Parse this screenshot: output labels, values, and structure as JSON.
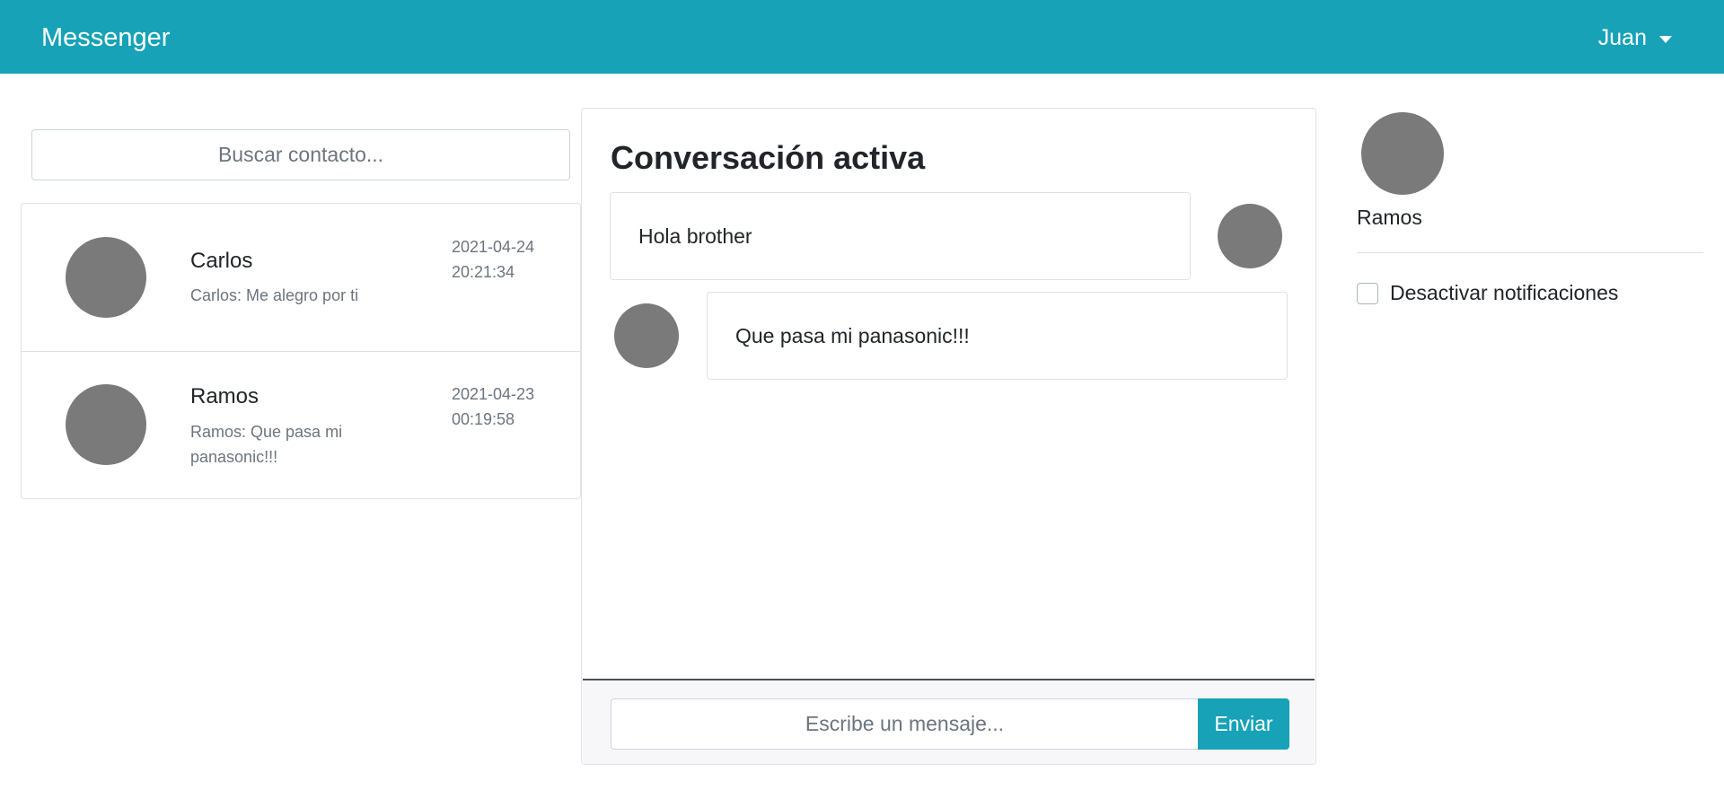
{
  "navbar": {
    "brand": "Messenger",
    "user": "Juan"
  },
  "search": {
    "placeholder": "Buscar contacto..."
  },
  "contacts": [
    {
      "name": "Carlos",
      "last_message": "Carlos: Me alegro por ti",
      "date": "2021-04-24",
      "time": "20:21:34"
    },
    {
      "name": "Ramos",
      "last_message": "Ramos: Que pasa mi panasonic!!!",
      "date": "2021-04-23",
      "time": "00:19:58"
    }
  ],
  "chat": {
    "title": "Conversación activa",
    "messages": [
      {
        "text": "Hola brother",
        "side": "sent"
      },
      {
        "text": "Que pasa mi panasonic!!!",
        "side": "received"
      }
    ],
    "input_placeholder": "Escribe un mensaje...",
    "send_label": "Enviar"
  },
  "profile": {
    "name": "Ramos",
    "notifications_label": "Desactivar notificaciones",
    "notifications_disabled": false
  },
  "icons": {
    "user_caret": "caret-down-icon"
  },
  "colors": {
    "primary": "#17a2b8",
    "avatar": "#7a7a7a"
  }
}
